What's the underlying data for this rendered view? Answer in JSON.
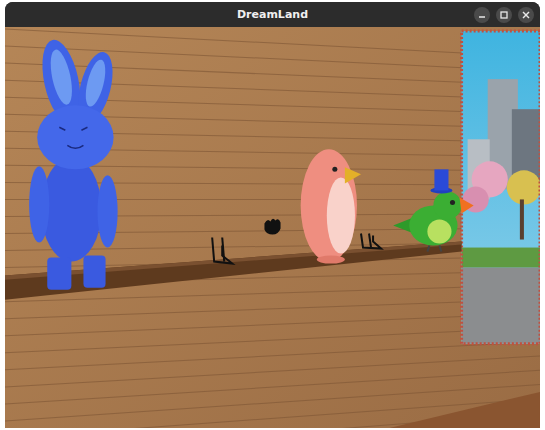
{
  "window": {
    "title": "DreamLand"
  }
}
